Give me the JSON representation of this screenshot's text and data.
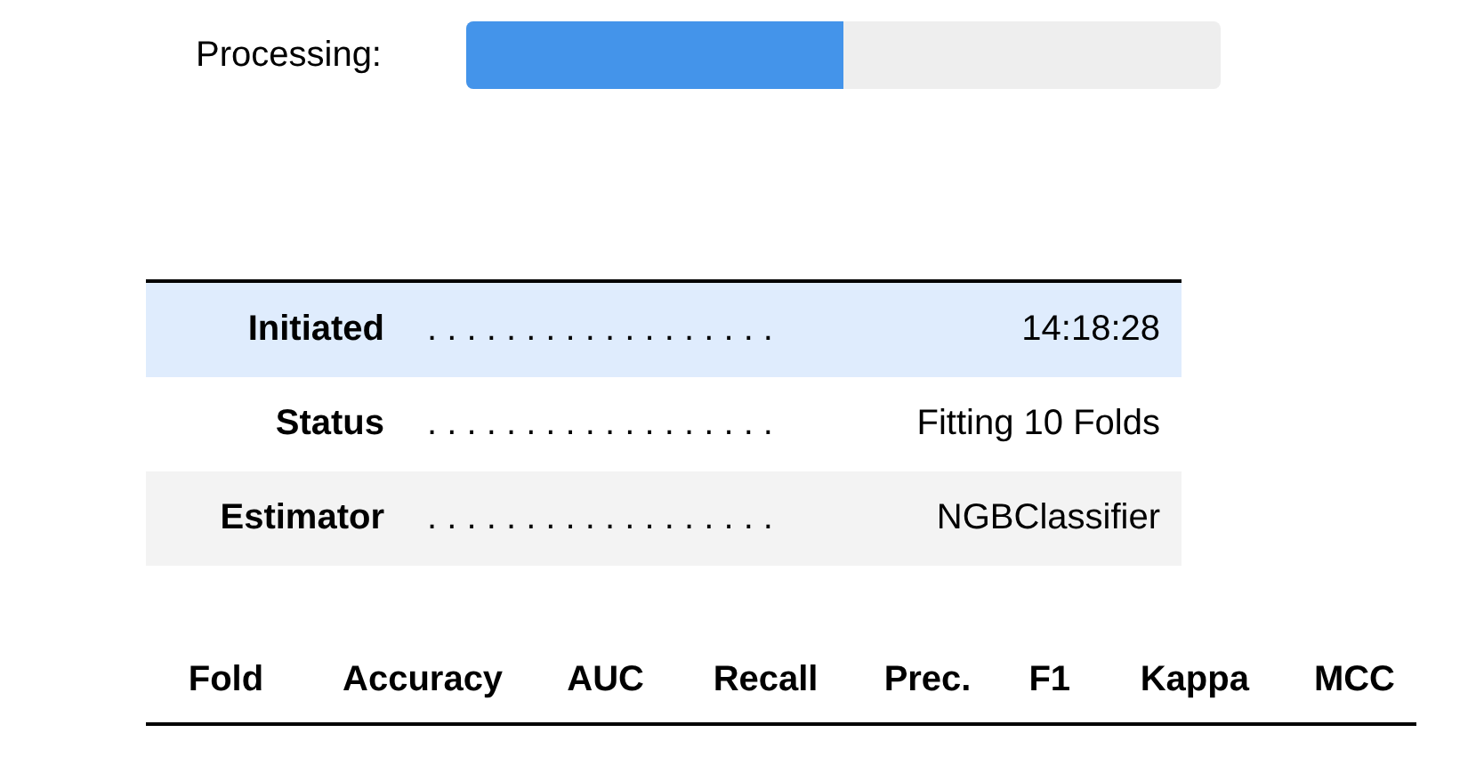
{
  "progress": {
    "label": "Processing:",
    "level": 0.5
  },
  "info_table": {
    "rows": [
      {
        "label": "Initiated",
        "dots": ". . . . . . . . . . . . . . . . . .",
        "value": "14:18:28",
        "selected": true
      },
      {
        "label": "Status",
        "dots": ". . . . . . . . . . . . . . . . . .",
        "value": "Fitting 10 Folds",
        "selected": false
      },
      {
        "label": "Estimator",
        "dots": ". . . . . . . . . . . . . . . . . .",
        "value": "NGBClassifier",
        "selected": false
      }
    ]
  },
  "results_table": {
    "columns": [
      "Fold",
      "Accuracy",
      "AUC",
      "Recall",
      "Prec.",
      "F1",
      "Kappa",
      "MCC"
    ]
  }
}
